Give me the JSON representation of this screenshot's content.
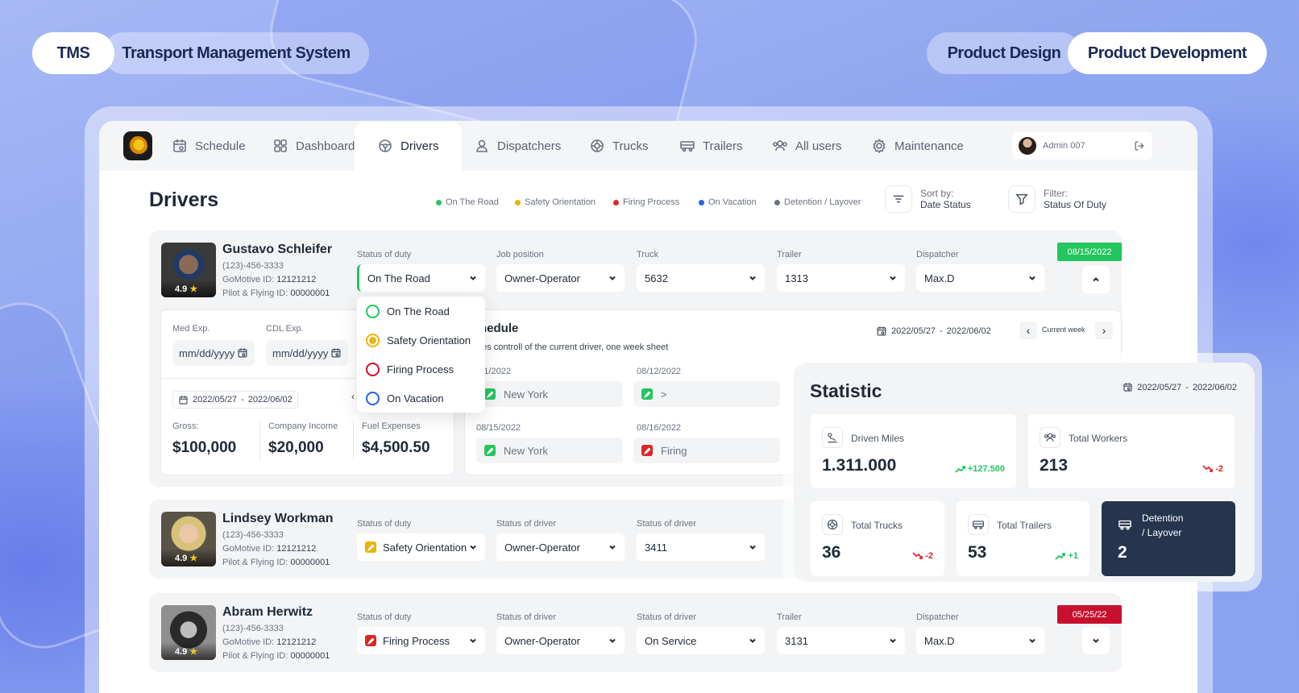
{
  "header": {
    "tms": "TMS",
    "system": "Transport Management System",
    "design": "Product Design",
    "development": "Product Development"
  },
  "nav": {
    "items": [
      "Schedule",
      "Dashboard",
      "Drivers",
      "Dispatchers",
      "Trucks",
      "Trailers",
      "All users",
      "Maintenance"
    ],
    "active": "Drivers",
    "admin": "Admin 007"
  },
  "page": {
    "title": "Drivers",
    "legend": [
      {
        "label": "On The Road",
        "color": "#22c55e"
      },
      {
        "label": "Safety Orientation",
        "color": "#eab308"
      },
      {
        "label": "Firing Process",
        "color": "#dc2626"
      },
      {
        "label": "On Vacation",
        "color": "#2563eb"
      },
      {
        "label": "Detention / Layover",
        "color": "#6b7280"
      }
    ],
    "sort_label": "Sort by:",
    "sort_value": "Date Status",
    "filter_label": "Filter:",
    "filter_value": "Status Of Duty"
  },
  "drivers": [
    {
      "name": "Gustavo Schleifer",
      "phone": "(123)-456-3333",
      "gomotive_label": "GoMotive ID:",
      "gomotive": "12121212",
      "pilot_label": "Pilot & Flying ID:",
      "pilot": "00000001",
      "rating": "4.9",
      "fields": [
        {
          "label": "Status of duty",
          "value": "On The Road"
        },
        {
          "label": "Job position",
          "value": "Owner-Operator"
        },
        {
          "label": "Truck",
          "value": "5632"
        },
        {
          "label": "Trailer",
          "value": "1313"
        },
        {
          "label": "Dispatcher",
          "value": "Max.D"
        }
      ],
      "date": "08/15/2022",
      "date_color": "#22c55e"
    },
    {
      "name": "Lindsey Workman",
      "phone": "(123)-456-3333",
      "gomotive_label": "GoMotive ID:",
      "gomotive": "12121212",
      "pilot_label": "Pilot & Flying ID:",
      "pilot": "00000001",
      "rating": "4.9",
      "fields": [
        {
          "label": "Status of duty",
          "value": "Safety Orientation"
        },
        {
          "label": "Status of driver",
          "value": "Owner-Operator"
        },
        {
          "label": "Status of driver",
          "value": "3411"
        }
      ]
    },
    {
      "name": "Abram Herwitz",
      "phone": "(123)-456-3333",
      "gomotive_label": "GoMotive ID:",
      "gomotive": "12121212",
      "pilot_label": "Pilot & Flying ID:",
      "pilot": "00000001",
      "rating": "4.9",
      "fields": [
        {
          "label": "Status of duty",
          "value": "Firing Process"
        },
        {
          "label": "Status of driver",
          "value": "Owner-Operator"
        },
        {
          "label": "Status of driver",
          "value": "On Service"
        },
        {
          "label": "Trailer",
          "value": "3131"
        },
        {
          "label": "Dispatcher",
          "value": "Max.D"
        }
      ],
      "date": "05/25/22",
      "date_color": "#c8102e"
    }
  ],
  "details": {
    "med_label": "Med Exp.",
    "cdl_label": "CDL Exp.",
    "date_placeholder": "mm/dd/yyyy",
    "range_start": "2022/05/27",
    "range_sep": "-",
    "range_end": "2022/06/02",
    "gross_label": "Gross:",
    "gross": "$100,000",
    "company_label": "Company Income",
    "company": "$20,000",
    "fuel_label": "Fuel Expenses",
    "fuel": "$4,500.50"
  },
  "schedule": {
    "title": "hedule",
    "subtitle": "tes controll of the current driver, one week sheet",
    "range_start": "2022/05/27",
    "range_sep": "-",
    "range_end": "2022/06/02",
    "current": "Current week",
    "cells": [
      {
        "date": "11/2022",
        "value": "New York",
        "status": "#22c55e"
      },
      {
        "date": "08/12/2022",
        "value": ">",
        "status": "#22c55e"
      },
      {
        "date": "08/15/2022",
        "value": "New York",
        "status": "#22c55e"
      },
      {
        "date": "08/16/2022",
        "value": "Firing",
        "status": "#dc2626"
      }
    ]
  },
  "status_menu": [
    {
      "label": "On The Road",
      "color": "#22c55e"
    },
    {
      "label": "Safety Orientation",
      "color": "#eab308",
      "selected": true
    },
    {
      "label": "Firing Process",
      "color": "#c8102e"
    },
    {
      "label": "On Vacation",
      "color": "#2563eb"
    }
  ],
  "statistic": {
    "title": "Statistic",
    "range_start": "2022/05/27",
    "range_sep": "-",
    "range_end": "2022/06/02",
    "miles_label": "Driven Miles",
    "miles": "1.311.000",
    "miles_trend": "+127.500",
    "workers_label": "Total Workers",
    "workers": "213",
    "workers_trend": "-2",
    "trucks_label": "Total Trucks",
    "trucks": "36",
    "trucks_trend": "-2",
    "trailers_label": "Total Trailers",
    "trailers": "53",
    "trailers_trend": "+1",
    "detention_label1": "Detention",
    "detention_label2": "/ Layover",
    "detention": "2"
  }
}
